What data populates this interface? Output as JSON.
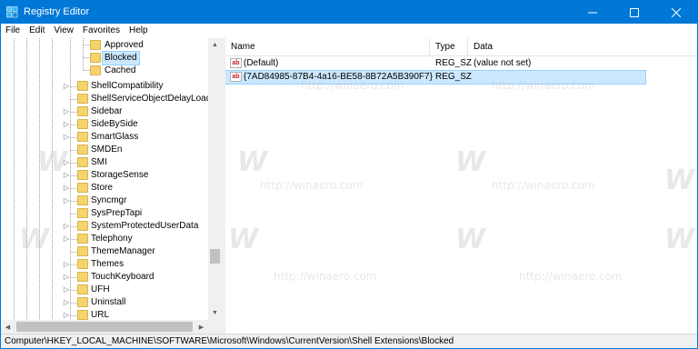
{
  "window": {
    "title": "Registry Editor",
    "app_icon": "registry-icon",
    "controls": [
      "minimize-icon",
      "maximize-icon",
      "close-icon"
    ]
  },
  "menu": {
    "items": [
      "File",
      "Edit",
      "View",
      "Favorites",
      "Help"
    ]
  },
  "tree": {
    "items": [
      {
        "label": "Approved",
        "has_children": false,
        "level": "child",
        "selected": false
      },
      {
        "label": "Blocked",
        "has_children": false,
        "level": "child",
        "selected": true
      },
      {
        "label": "Cached",
        "has_children": false,
        "level": "child",
        "selected": false
      },
      {
        "label": "ShellCompatibility",
        "has_children": true,
        "level": "key",
        "selected": false
      },
      {
        "label": "ShellServiceObjectDelayLoad",
        "has_children": false,
        "level": "key",
        "selected": false
      },
      {
        "label": "Sidebar",
        "has_children": true,
        "level": "key",
        "selected": false
      },
      {
        "label": "SideBySide",
        "has_children": true,
        "level": "key",
        "selected": false
      },
      {
        "label": "SmartGlass",
        "has_children": true,
        "level": "key",
        "selected": false
      },
      {
        "label": "SMDEn",
        "has_children": false,
        "level": "key",
        "selected": false
      },
      {
        "label": "SMI",
        "has_children": true,
        "level": "key",
        "selected": false
      },
      {
        "label": "StorageSense",
        "has_children": true,
        "level": "key",
        "selected": false
      },
      {
        "label": "Store",
        "has_children": true,
        "level": "key",
        "selected": false
      },
      {
        "label": "Syncmgr",
        "has_children": true,
        "level": "key",
        "selected": false
      },
      {
        "label": "SysPrepTapi",
        "has_children": false,
        "level": "key",
        "selected": false
      },
      {
        "label": "SystemProtectedUserData",
        "has_children": true,
        "level": "key",
        "selected": false
      },
      {
        "label": "Telephony",
        "has_children": true,
        "level": "key",
        "selected": false
      },
      {
        "label": "ThemeManager",
        "has_children": false,
        "level": "key",
        "selected": false
      },
      {
        "label": "Themes",
        "has_children": true,
        "level": "key",
        "selected": false
      },
      {
        "label": "TouchKeyboard",
        "has_children": true,
        "level": "key",
        "selected": false
      },
      {
        "label": "UFH",
        "has_children": true,
        "level": "key",
        "selected": false
      },
      {
        "label": "Uninstall",
        "has_children": true,
        "level": "key",
        "selected": false
      },
      {
        "label": "URL",
        "has_children": true,
        "level": "key",
        "selected": false
      }
    ]
  },
  "list": {
    "columns": {
      "name": "Name",
      "type": "Type",
      "data": "Data"
    },
    "rows": [
      {
        "icon": "string-value-icon",
        "name": "(Default)",
        "type": "REG_SZ",
        "data": "(value not set)",
        "selected": false
      },
      {
        "icon": "string-value-icon",
        "name": "{7AD84985-87B4-4a16-BE58-8B72A5B390F7}",
        "type": "REG_SZ",
        "data": "",
        "selected": true
      }
    ]
  },
  "watermark": {
    "text": "http://winaero.com",
    "logo": "W"
  },
  "status": {
    "path": "Computer\\HKEY_LOCAL_MACHINE\\SOFTWARE\\Microsoft\\Windows\\CurrentVersion\\Shell Extensions\\Blocked"
  },
  "colors": {
    "title_bar": "#0078d7",
    "selection": "#cce8ff",
    "folder": "#f5d46c"
  }
}
